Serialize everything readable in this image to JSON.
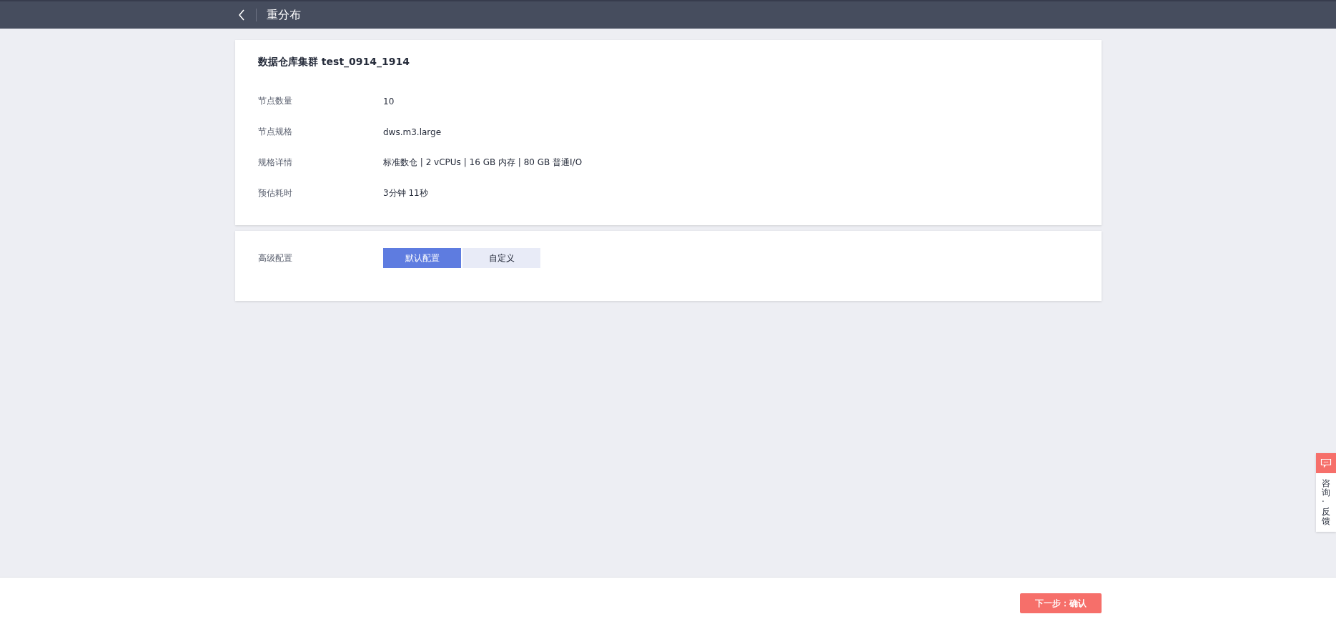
{
  "header": {
    "title": "重分布"
  },
  "cluster_card": {
    "title": "数据仓库集群 test_0914_1914",
    "rows": [
      {
        "label": "节点数量",
        "value": "10"
      },
      {
        "label": "节点规格",
        "value": "dws.m3.large"
      },
      {
        "label": "规格详情",
        "value": "标准数仓 | 2 vCPUs | 16 GB 内存 | 80 GB 普通I/O"
      },
      {
        "label": "预估耗时",
        "value": "3分钟 11秒"
      }
    ]
  },
  "advanced_config": {
    "label": "高级配置",
    "options": [
      {
        "label": "默认配置",
        "selected": true
      },
      {
        "label": "自定义",
        "selected": false
      }
    ]
  },
  "feedback": {
    "label": "咨询·反馈"
  },
  "footer": {
    "next_button": "下一步：确认"
  }
}
